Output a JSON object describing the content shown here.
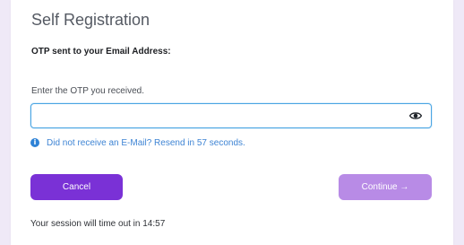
{
  "page": {
    "title": "Self Registration",
    "subtitle": "OTP sent to your Email Address:"
  },
  "otp": {
    "label": "Enter the OTP you received.",
    "value": "",
    "placeholder": "",
    "toggle_icon": "eye-icon"
  },
  "resend": {
    "icon": "info-icon",
    "text": "Did not receive an E-Mail? Resend in 57 seconds."
  },
  "actions": {
    "cancel_label": "Cancel",
    "continue_label": "Continue →"
  },
  "session": {
    "text": "Your session will time out in 14:57"
  },
  "colors": {
    "background": "#efe9f7",
    "field_border": "#4aa5e3",
    "info_link": "#3e84d4",
    "cancel_button": "#7a31d6",
    "continue_button": "#b88be6"
  }
}
